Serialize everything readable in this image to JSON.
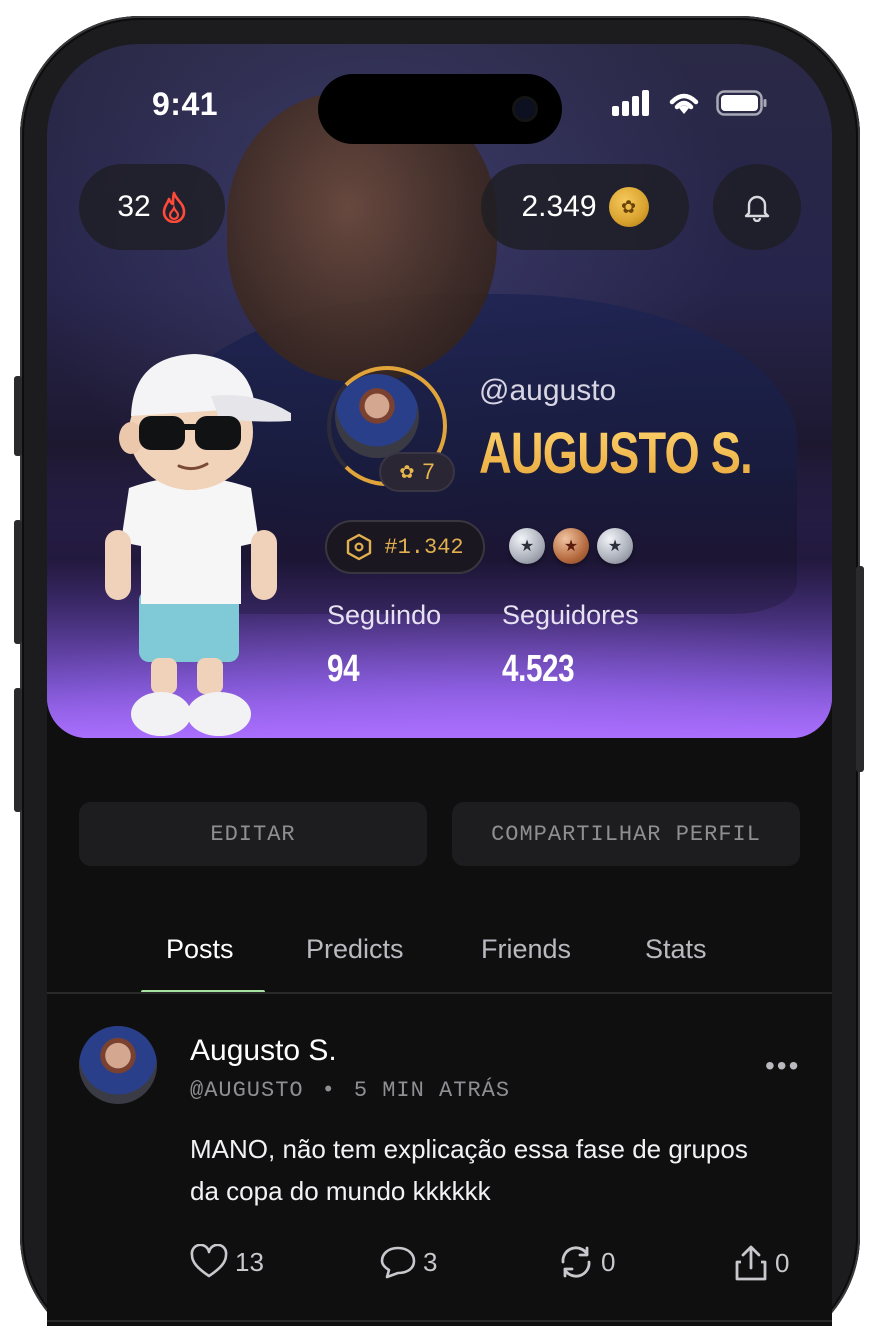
{
  "status_bar": {
    "time": "9:41"
  },
  "header": {
    "streak": {
      "value": "32",
      "icon": "flame-icon"
    },
    "coins": {
      "value": "2.349",
      "icon": "coin-icon"
    },
    "notifications_icon": "bell-icon"
  },
  "profile": {
    "handle": "@augusto",
    "name": "AUGUSTO S.",
    "level": "7",
    "rank": "#1.342",
    "medals": [
      "silver",
      "bronze",
      "silver"
    ],
    "stats": [
      {
        "label": "Seguindo",
        "value": "94"
      },
      {
        "label": "Seguidores",
        "value": "4.523"
      }
    ]
  },
  "actions": {
    "edit": "EDITAR",
    "share": "COMPARTILHAR PERFIL"
  },
  "tabs": [
    {
      "label": "Posts",
      "active": true
    },
    {
      "label": "Predicts",
      "active": false
    },
    {
      "label": "Friends",
      "active": false
    },
    {
      "label": "Stats",
      "active": false
    }
  ],
  "post": {
    "author": "Augusto S.",
    "handle": "@AUGUSTO",
    "separator": "•",
    "time": "5 MIN ATRÁS",
    "text": "MANO, não tem explicação essa fase de grupos da copa do mundo kkkkkk",
    "likes": "13",
    "comments": "3",
    "reposts": "0",
    "shares": "0"
  },
  "colors": {
    "accent_gold": "#e6a63a",
    "tab_indicator": "#a7e3a0",
    "streak_red": "#ff4a3a"
  }
}
